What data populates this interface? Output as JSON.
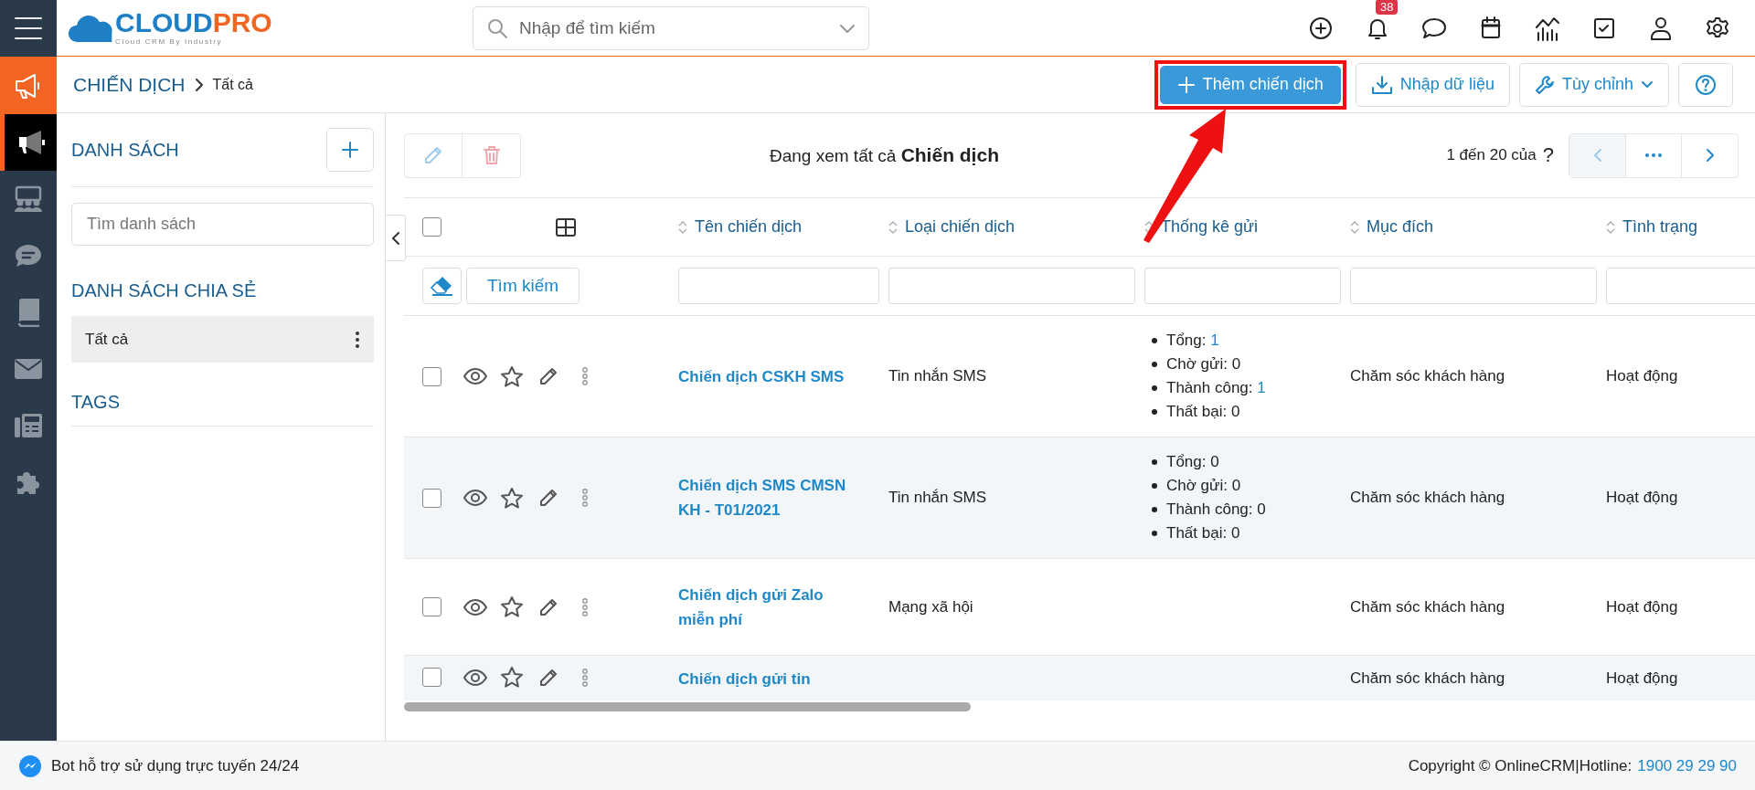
{
  "header": {
    "logo_main": "CLOUD",
    "logo_accent": "PRO",
    "logo_tagline": "Cloud CRM By Industry",
    "search_placeholder": "Nhập để tìm kiếm",
    "notification_badge": "38"
  },
  "nav_rail": [
    {
      "selected": true
    },
    {
      "selected": false
    },
    {
      "selected": false
    },
    {
      "selected": false
    },
    {
      "selected": false
    },
    {
      "selected": false
    },
    {
      "selected": false
    }
  ],
  "breadcrumb": {
    "module": "CHIẾN DỊCH",
    "current": "Tất cả"
  },
  "actions": [
    {
      "kind": "primary",
      "label": "Thêm chiến dịch"
    },
    {
      "kind": "import",
      "label": "Nhập dữ liệu"
    },
    {
      "kind": "menu",
      "label": "Tùy chỉnh"
    },
    {
      "kind": "help"
    }
  ],
  "list_panel": {
    "title": "DANH SÁCH",
    "search_placeholder": "Tìm danh sách",
    "shared_title": "DANH SÁCH CHIA SẺ",
    "shared_items": [
      {
        "label": "Tất cả",
        "selected": true
      }
    ],
    "tags_title": "TAGS"
  },
  "toolbar": {
    "viewing": "Đang xem tất cả **Chiến dịch**",
    "range": "1 đến 20 của",
    "total": "?",
    "prev_disabled": true
  },
  "table": {
    "select_all": false,
    "columns": [
      "Tên chiến dịch",
      "Loại chiến dịch",
      "Thống kê gửi",
      "Mục đích",
      "Tình trạng"
    ],
    "filter_button": "Tìm kiếm",
    "rows": [
      {
        "checked": false,
        "name": "Chiến dịch CSKH SMS",
        "type": "Tin nhắn SMS",
        "stats": [
          {
            "label": "Tổng:",
            "value": "1",
            "link": true
          },
          {
            "label": "Chờ gửi:",
            "value": "0",
            "link": false
          },
          {
            "label": "Thành công:",
            "value": "1",
            "link": true
          },
          {
            "label": "Thất bại:",
            "value": "0",
            "link": false
          }
        ],
        "purpose": "Chăm sóc khách hàng",
        "status": "Hoạt động"
      },
      {
        "checked": false,
        "name": "Chiến dịch SMS CMSN KH - T01/2021",
        "type": "Tin nhắn SMS",
        "stats": [
          {
            "label": "Tổng:",
            "value": "0",
            "link": false
          },
          {
            "label": "Chờ gửi:",
            "value": "0",
            "link": false
          },
          {
            "label": "Thành công:",
            "value": "0",
            "link": false
          },
          {
            "label": "Thất bại:",
            "value": "0",
            "link": false
          }
        ],
        "purpose": "Chăm sóc khách hàng",
        "status": "Hoạt động"
      },
      {
        "checked": false,
        "name": "Chiến dịch gửi Zalo miễn phí",
        "type": "Mạng xã hội",
        "purpose": "Chăm sóc khách hàng",
        "status": "Hoạt động"
      },
      {
        "checked": false,
        "name": "Chiến dịch gửi tin",
        "purpose": "Chăm sóc khách hàng",
        "status": "Hoạt động"
      }
    ]
  },
  "footer": {
    "bot": "Bot hỗ trợ sử dụng trực tuyến 24/24",
    "copyright": "Copyright © OnlineCRM|Hotline:",
    "hotline": "1900 29 29 90"
  }
}
